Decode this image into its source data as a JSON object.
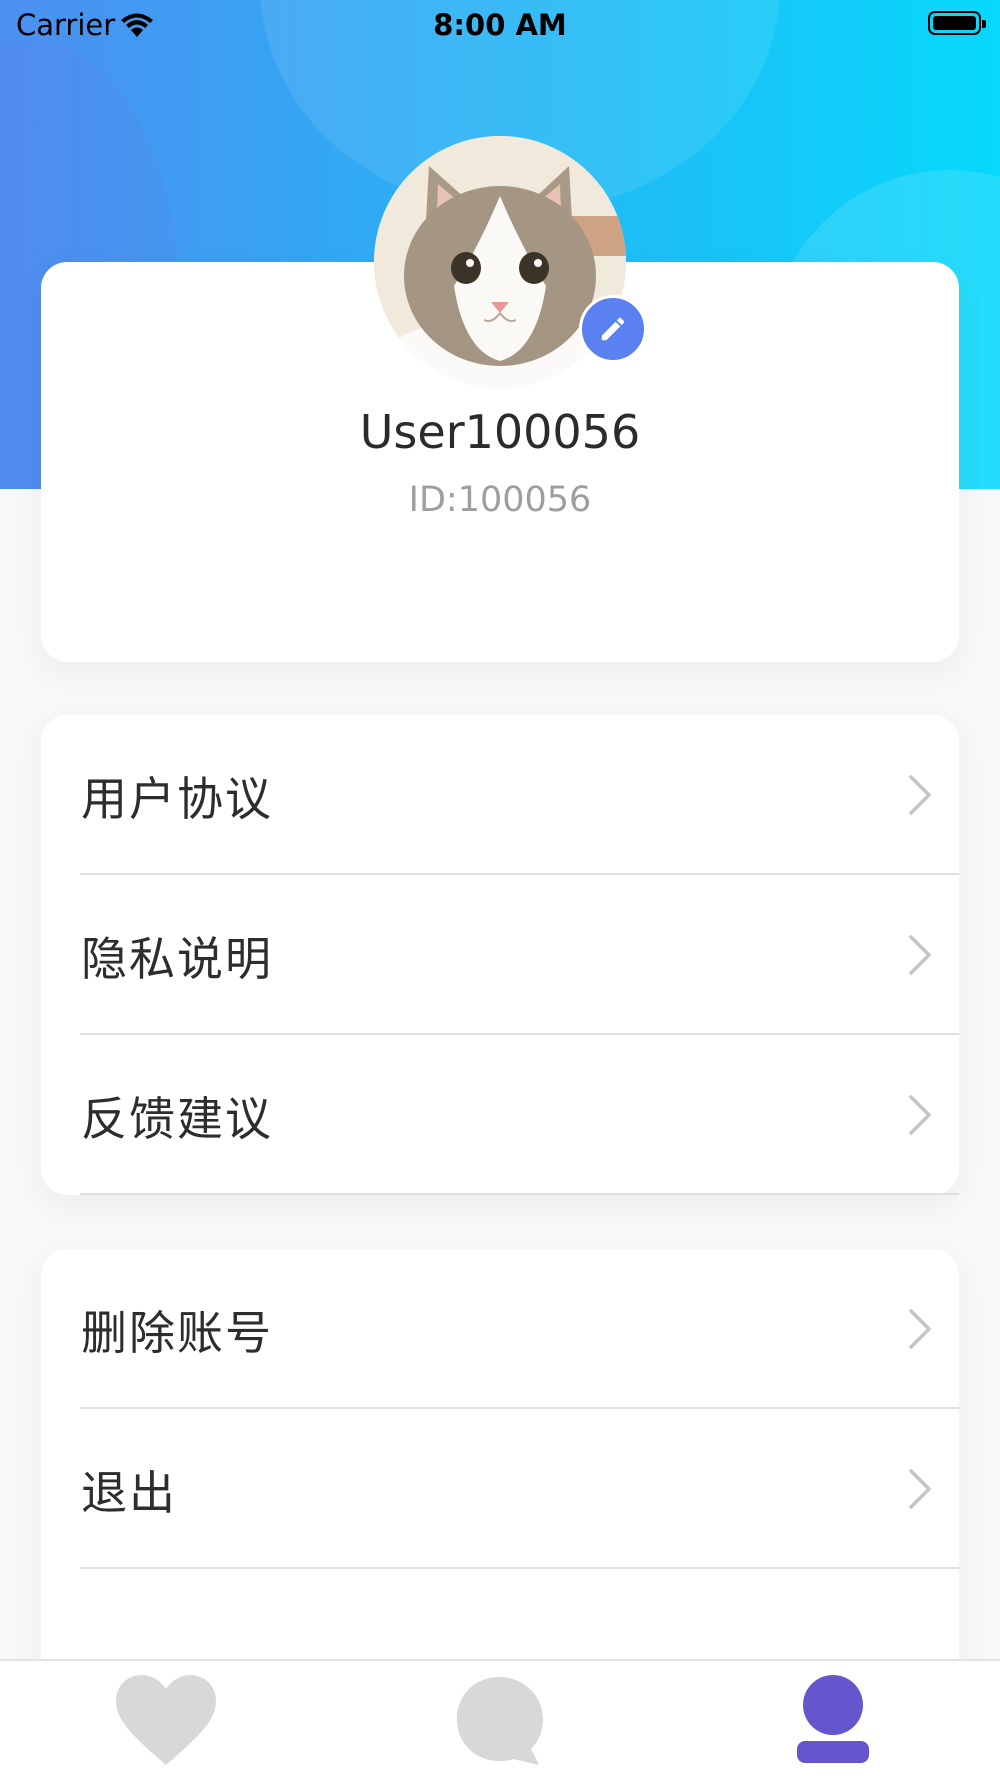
{
  "status_bar": {
    "carrier": "Carrier",
    "time": "8:00 AM"
  },
  "profile": {
    "username": "User100056",
    "user_id": "ID:100056"
  },
  "menu_group_1": [
    {
      "label": "用户协议",
      "icon": "chevron-right-icon"
    },
    {
      "label": "隐私说明",
      "icon": "chevron-right-icon"
    },
    {
      "label": "反馈建议",
      "icon": "chevron-right-icon"
    }
  ],
  "menu_group_2": [
    {
      "label": "删除账号",
      "icon": "chevron-right-icon"
    },
    {
      "label": "退出",
      "icon": "chevron-right-icon"
    }
  ],
  "tab_bar": [
    {
      "icon": "heart-icon",
      "selected": false
    },
    {
      "icon": "chat-bubble-icon",
      "selected": false
    },
    {
      "icon": "profile-icon",
      "selected": true
    }
  ],
  "colors": {
    "header_gradient_start": "#4d8ff0",
    "header_gradient_end": "#06d9fb",
    "edit_button": "#5b80f0",
    "tab_selected": "#6456cc",
    "tab_unselected": "#d8d8d8"
  }
}
